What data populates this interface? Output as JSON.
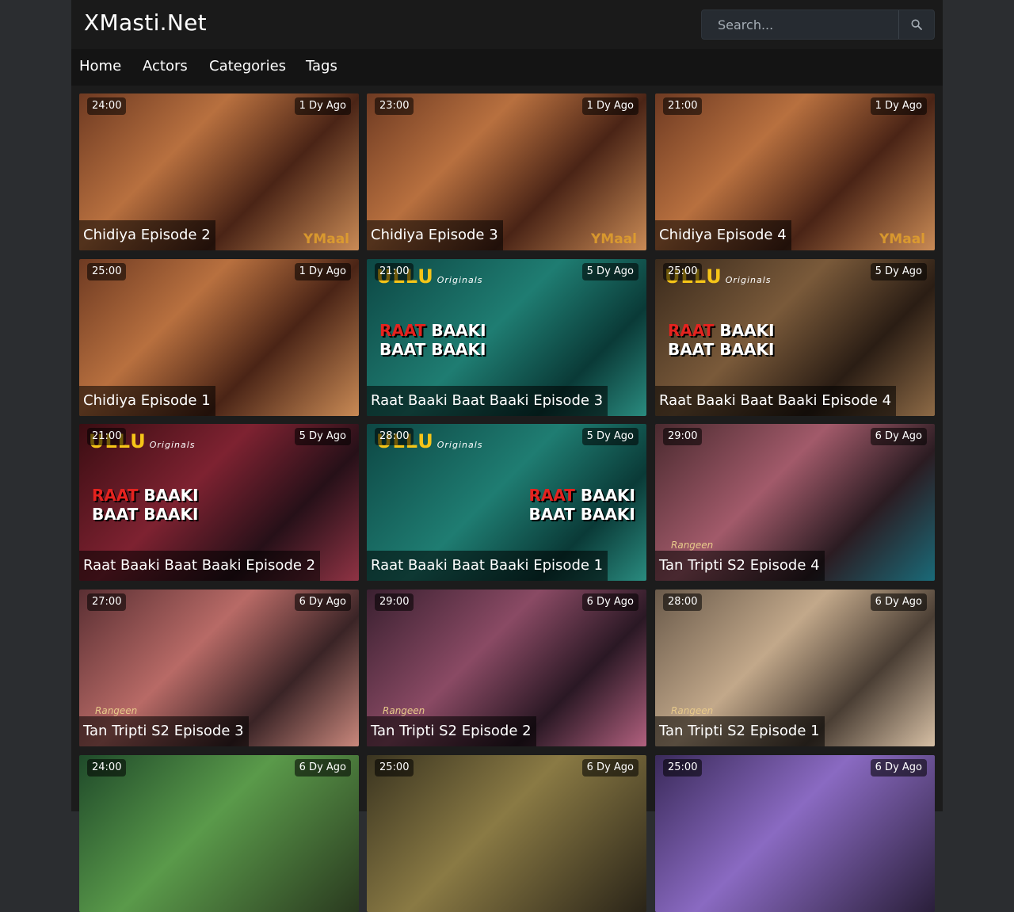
{
  "site": {
    "title": "XMasti.Net"
  },
  "search": {
    "placeholder": "Search..."
  },
  "nav": [
    {
      "label": "Home"
    },
    {
      "label": "Actors"
    },
    {
      "label": "Categories"
    },
    {
      "label": "Tags"
    }
  ],
  "videos": [
    {
      "title": "Chidiya Episode 2",
      "duration": "24:00",
      "ago": "1 Dy Ago",
      "watermark": "YMaal",
      "theme": "warm"
    },
    {
      "title": "Chidiya Episode 3",
      "duration": "23:00",
      "ago": "1 Dy Ago",
      "watermark": "YMaal",
      "theme": "warm"
    },
    {
      "title": "Chidiya Episode 4",
      "duration": "21:00",
      "ago": "1 Dy Ago",
      "watermark": "YMaal",
      "theme": "warm"
    },
    {
      "title": "Chidiya Episode 1",
      "duration": "25:00",
      "ago": "1 Dy Ago",
      "theme": "warm"
    },
    {
      "title": "Raat Baaki Baat Baaki Episode 3",
      "duration": "21:00",
      "ago": "5 Dy Ago",
      "brand": "ULLU",
      "brand_sub": "Originals",
      "show_red": "RAAT",
      "show_rest": "BAAKI",
      "show_line2": "BAAT BAAKI",
      "theme": "teal"
    },
    {
      "title": "Raat Baaki Baat Baaki Episode 4",
      "duration": "25:00",
      "ago": "5 Dy Ago",
      "brand": "ULLU",
      "brand_sub": "Originals",
      "show_red": "RAAT",
      "show_rest": "BAAKI",
      "show_line2": "BAAT BAAKI",
      "theme": "brown"
    },
    {
      "title": "Raat Baaki Baat Baaki Episode 2",
      "duration": "21:00",
      "ago": "5 Dy Ago",
      "brand": "ULLU",
      "brand_sub": "Originals",
      "show_red": "RAAT",
      "show_rest": "BAAKI",
      "show_line2": "BAAT BAAKI",
      "theme": "maroon"
    },
    {
      "title": "Raat Baaki Baat Baaki Episode 1",
      "duration": "28:00",
      "ago": "5 Dy Ago",
      "brand": "ULLU",
      "brand_sub": "Originals",
      "show_red": "RAAT",
      "show_rest": "BAAKI",
      "show_line2": "BAAT BAAKI",
      "show_right": true,
      "theme": "teal"
    },
    {
      "title": "Tan Tripti S2 Episode 4",
      "duration": "29:00",
      "ago": "6 Dy Ago",
      "rangeen": "Rangeen",
      "theme": "pink"
    },
    {
      "title": "Tan Tripti S2 Episode 3",
      "duration": "27:00",
      "ago": "6 Dy Ago",
      "rangeen": "Rangeen",
      "theme": "rose"
    },
    {
      "title": "Tan Tripti S2 Episode 2",
      "duration": "29:00",
      "ago": "6 Dy Ago",
      "rangeen": "Rangeen",
      "theme": "mauve"
    },
    {
      "title": "Tan Tripti S2 Episode 1",
      "duration": "28:00",
      "ago": "6 Dy Ago",
      "rangeen": "Rangeen",
      "theme": "sand"
    },
    {
      "title": "",
      "duration": "24:00",
      "ago": "6 Dy Ago",
      "theme": "green"
    },
    {
      "title": "",
      "duration": "25:00",
      "ago": "6 Dy Ago",
      "theme": "olive"
    },
    {
      "title": "",
      "duration": "25:00",
      "ago": "6 Dy Ago",
      "theme": "violet"
    }
  ],
  "colors": {
    "page_bg": "#2b2d30",
    "container_bg": "#1c1c1c",
    "header_bg": "#1a1a1a",
    "nav_bg": "#141414",
    "search_bg": "#262b31",
    "placeholder": "#a5adb5"
  }
}
